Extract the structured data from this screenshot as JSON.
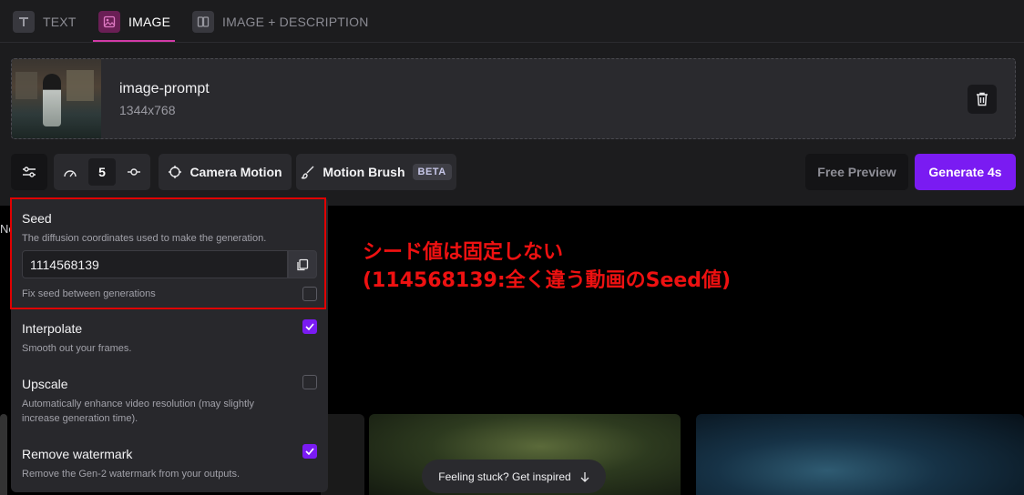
{
  "tabs": [
    {
      "label": "TEXT",
      "icon": "text-icon"
    },
    {
      "label": "IMAGE",
      "icon": "image-icon",
      "active": true
    },
    {
      "label": "IMAGE + DESCRIPTION",
      "icon": "image-description-icon"
    }
  ],
  "prompt_card": {
    "title": "image-prompt",
    "dimensions": "1344x768"
  },
  "toolbar": {
    "speed_value": "5",
    "camera_motion_label": "Camera Motion",
    "motion_brush_label": "Motion Brush",
    "beta_label": "BETA",
    "free_preview_label": "Free Preview",
    "generate_label": "Generate 4s"
  },
  "settings": {
    "seed": {
      "title": "Seed",
      "description": "The diffusion coordinates used to make the generation.",
      "value": "1114568139",
      "fix_label": "Fix seed between generations",
      "fixed": false
    },
    "interpolate": {
      "title": "Interpolate",
      "description": "Smooth out your frames.",
      "checked": true
    },
    "upscale": {
      "title": "Upscale",
      "description": "Automatically enhance video resolution (may slightly increase generation time).",
      "checked": false
    },
    "remove_watermark": {
      "title": "Remove watermark",
      "description": "Remove the Gen-2 watermark from your outputs.",
      "checked": true
    }
  },
  "stray_text": "Ne",
  "annotation": {
    "line1": "シード値は固定しない",
    "line2": "(114568139:全く違う動画のSeed値)"
  },
  "inspire_label": "Feeling stuck? Get inspired",
  "colors": {
    "accent": "#7a1bf2",
    "tab_active": "#d13aa6",
    "annotation": "#ee1111"
  }
}
